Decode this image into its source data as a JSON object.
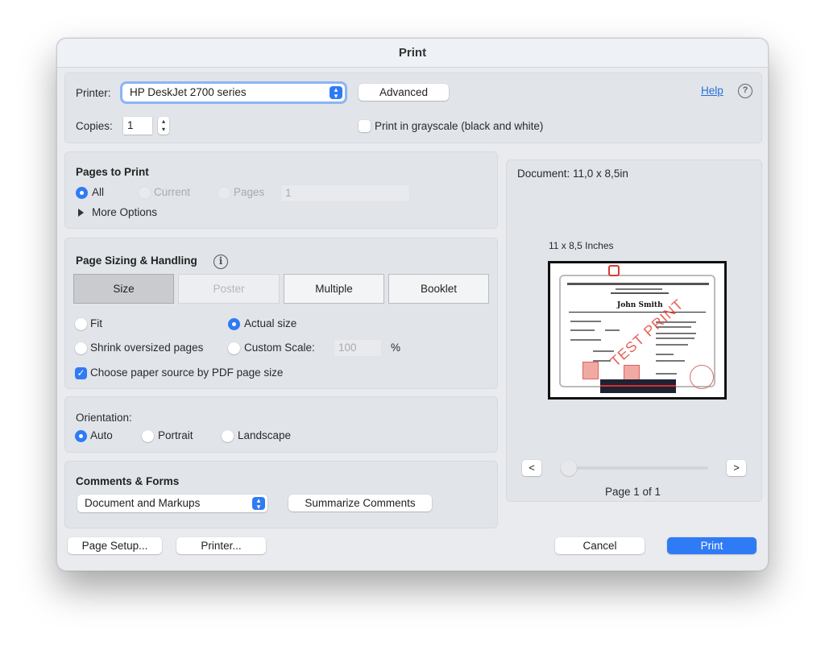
{
  "window": {
    "title": "Print"
  },
  "printer": {
    "label": "Printer:",
    "selected": "HP DeskJet 2700 series",
    "advanced_button": "Advanced",
    "help_link": "Help",
    "copies_label": "Copies:",
    "copies_value": "1",
    "grayscale_label": "Print in grayscale (black and white)",
    "grayscale_checked": false
  },
  "pages_to_print": {
    "heading": "Pages to Print",
    "options": [
      {
        "label": "All",
        "selected": true,
        "enabled": true
      },
      {
        "label": "Current",
        "selected": false,
        "enabled": false
      },
      {
        "label": "Pages",
        "selected": false,
        "enabled": false
      }
    ],
    "pages_field_value": "1",
    "more_options": "More Options"
  },
  "page_sizing": {
    "heading": "Page Sizing & Handling",
    "tabs": [
      {
        "label": "Size",
        "selected": true,
        "enabled": true
      },
      {
        "label": "Poster",
        "selected": false,
        "enabled": false
      },
      {
        "label": "Multiple",
        "selected": false,
        "enabled": true
      },
      {
        "label": "Booklet",
        "selected": false,
        "enabled": true
      }
    ],
    "scale_options": [
      {
        "label": "Fit",
        "selected": false
      },
      {
        "label": "Actual size",
        "selected": true
      },
      {
        "label": "Shrink oversized pages",
        "selected": false
      },
      {
        "label": "Custom Scale:",
        "selected": false
      }
    ],
    "custom_scale_value": "100",
    "percent_symbol": "%",
    "paper_source_label": "Choose paper source by PDF page size",
    "paper_source_checked": true
  },
  "orientation": {
    "heading": "Orientation:",
    "options": [
      {
        "label": "Auto",
        "selected": true
      },
      {
        "label": "Portrait",
        "selected": false
      },
      {
        "label": "Landscape",
        "selected": false
      }
    ]
  },
  "comments_forms": {
    "heading": "Comments & Forms",
    "selected": "Document and Markups",
    "summarize_button": "Summarize Comments"
  },
  "preview": {
    "document_size": "Document: 11,0 x 8,5in",
    "page_size_label": "11 x 8,5 Inches",
    "watermark": "TEST PRINT",
    "recipient_name": "John Smith",
    "prev_button": "<",
    "next_button": ">",
    "page_indicator": "Page 1 of 1",
    "current_page": 1,
    "total_pages": 1
  },
  "footer": {
    "page_setup_button": "Page Setup...",
    "printer_button": "Printer...",
    "cancel_button": "Cancel",
    "print_button": "Print"
  },
  "colors": {
    "accent": "#2f7bf5",
    "window_bg": "#e9ebef",
    "panel_bg": "#e1e4e9",
    "link": "#2a6fdb"
  }
}
